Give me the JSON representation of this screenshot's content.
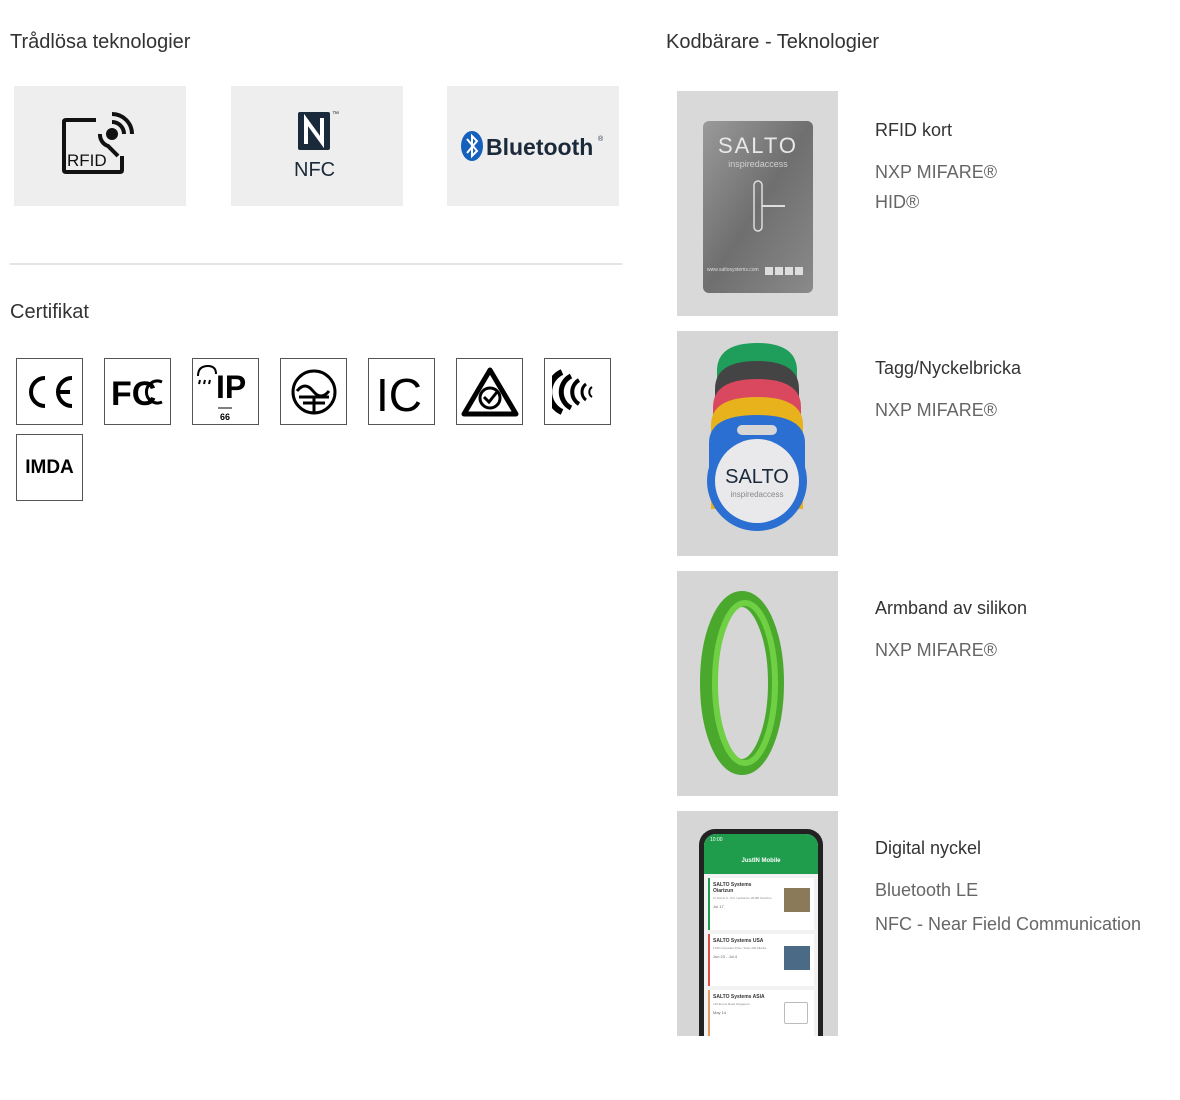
{
  "wireless": {
    "title": "Trådlösa teknologier",
    "items": [
      {
        "icon": "rfid-logo",
        "text": "RFID"
      },
      {
        "icon": "nfc-logo",
        "text": "NFC",
        "mark": "™"
      },
      {
        "icon": "bluetooth-logo",
        "text": "Bluetooth",
        "mark": "®"
      }
    ]
  },
  "certificates": {
    "title": "Certifikat",
    "items": [
      {
        "icon": "ce-mark",
        "text": "CE"
      },
      {
        "icon": "fcc-mark",
        "text": "FC"
      },
      {
        "icon": "ip66-mark",
        "text": "IP",
        "sub": "66"
      },
      {
        "icon": "japan-telec-mark"
      },
      {
        "icon": "ic-mark",
        "text": "IC"
      },
      {
        "icon": "rcm-mark"
      },
      {
        "icon": "anatel-mark"
      },
      {
        "icon": "imda-mark",
        "text": "IMDA"
      }
    ]
  },
  "carriers": {
    "title": "Kodbärare - Teknologier",
    "items": [
      {
        "name": "RFID kort",
        "specs": [
          "NXP MIFARE®",
          "HID®"
        ],
        "image": "rfid-card",
        "image_text": {
          "brand": "SALTO",
          "tagline": "inspiredaccess",
          "url": "www.saltosystems.com"
        }
      },
      {
        "name": "Tagg/Nyckelbricka",
        "specs": [
          "NXP MIFARE®"
        ],
        "image": "key-fob",
        "image_text": {
          "brand": "SALTO",
          "tagline": "inspiredaccess"
        },
        "colors": [
          "#1e9e5a",
          "#444444",
          "#d9485f",
          "#e8b21c",
          "#2a6fd1"
        ]
      },
      {
        "name": "Armband av silikon",
        "specs": [
          "NXP MIFARE®"
        ],
        "image": "silicone-wristband",
        "colors": [
          "#5cc23a"
        ]
      },
      {
        "name": "Digital nyckel",
        "specs": [
          "Bluetooth LE",
          "NFC - Near Field Communication"
        ],
        "image": "phone-app",
        "image_text": {
          "app_title": "JustIN Mobile",
          "time": "10:00",
          "cards": [
            {
              "title": "SALTO Systems Oiartzun",
              "addr": "C/ Arkotz 9 - Pol. Lanbarren 20180 Oiartzun",
              "date": "Jul 17"
            },
            {
              "title": "SALTO Systems USA",
              "addr": "1780 Corporate Drive, Suite 400 Atlanta",
              "date": "Jun 23 - Jul 4"
            },
            {
              "title": "SALTO Systems ASIA",
              "addr": "115 Eunos Road Singapore",
              "date": "May 14"
            }
          ]
        }
      }
    ]
  },
  "colors": {
    "text": "#333333",
    "muted": "#666666",
    "tile_bg": "#eeeeee",
    "image_bg": "#d6d6d6",
    "bluetooth_blue": "#1560bd",
    "app_green": "#1f9d4c"
  }
}
